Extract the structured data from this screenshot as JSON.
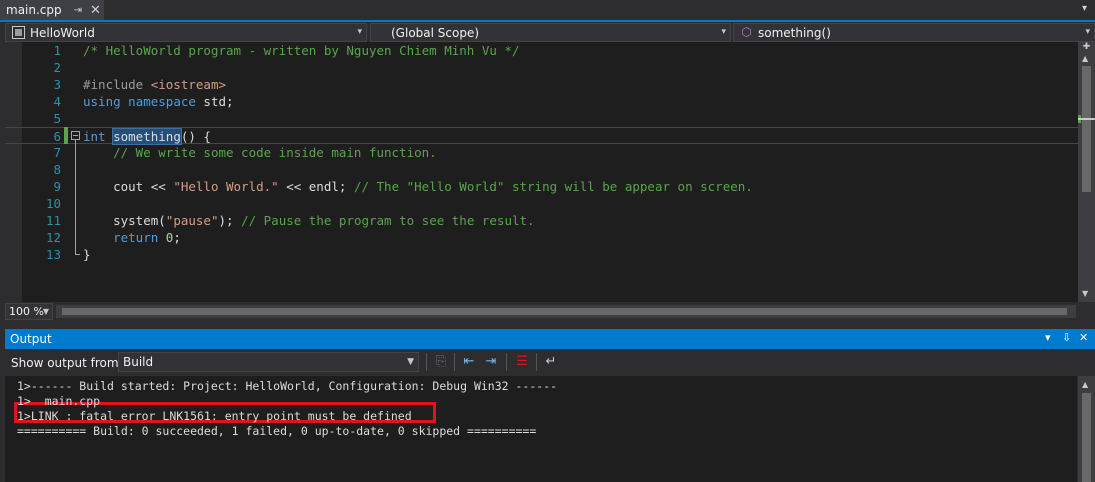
{
  "tabs": [
    {
      "label": "main.cpp",
      "pin": "⇥",
      "close": "✕"
    }
  ],
  "tab_overflow": "▾",
  "nav": {
    "project": "HelloWorld",
    "scope": "(Global Scope)",
    "function": "something()",
    "arrow": "▾"
  },
  "editor": {
    "zoom": "100 %",
    "current_line": 6,
    "lines": [
      {
        "n": "1",
        "tokens": [
          {
            "t": "/* HelloWorld program - written by Nguyen Chiem Minh Vu */",
            "c": "c-comment"
          }
        ]
      },
      {
        "n": "2",
        "tokens": []
      },
      {
        "n": "3",
        "tokens": [
          {
            "t": "#include ",
            "c": "c-pre"
          },
          {
            "t": "<iostream>",
            "c": "c-str"
          }
        ]
      },
      {
        "n": "4",
        "tokens": [
          {
            "t": "using",
            "c": "c-kw"
          },
          {
            "t": " ",
            "c": "c-plain"
          },
          {
            "t": "namespace",
            "c": "c-kw"
          },
          {
            "t": " std;",
            "c": "c-plain"
          }
        ]
      },
      {
        "n": "5",
        "tokens": []
      },
      {
        "n": "6",
        "tokens": [
          {
            "t": "int",
            "c": "c-kw"
          },
          {
            "t": " ",
            "c": "c-plain"
          },
          {
            "t": "something",
            "c": "c-fn"
          },
          {
            "t": "() {",
            "c": "c-plain"
          }
        ]
      },
      {
        "n": "7",
        "tokens": [
          {
            "t": "    ",
            "c": "c-plain"
          },
          {
            "t": "// We write some code inside main function.",
            "c": "c-comment"
          }
        ]
      },
      {
        "n": "8",
        "tokens": []
      },
      {
        "n": "9",
        "tokens": [
          {
            "t": "    cout << ",
            "c": "c-plain"
          },
          {
            "t": "\"Hello World.\"",
            "c": "c-str"
          },
          {
            "t": " << endl; ",
            "c": "c-plain"
          },
          {
            "t": "// The \"Hello World\" string will be appear on screen.",
            "c": "c-comment"
          }
        ]
      },
      {
        "n": "10",
        "tokens": []
      },
      {
        "n": "11",
        "tokens": [
          {
            "t": "    system(",
            "c": "c-plain"
          },
          {
            "t": "\"pause\"",
            "c": "c-str"
          },
          {
            "t": "); ",
            "c": "c-plain"
          },
          {
            "t": "// Pause the program to see the result.",
            "c": "c-comment"
          }
        ]
      },
      {
        "n": "12",
        "tokens": [
          {
            "t": "    ",
            "c": "c-plain"
          },
          {
            "t": "return",
            "c": "c-kw"
          },
          {
            "t": " ",
            "c": "c-plain"
          },
          {
            "t": "0",
            "c": "c-num"
          },
          {
            "t": ";",
            "c": "c-plain"
          }
        ]
      },
      {
        "n": "13",
        "tokens": [
          {
            "t": "}",
            "c": "c-plain"
          }
        ]
      }
    ]
  },
  "output": {
    "title": "Output",
    "controls": {
      "menu": "▾",
      "pin": "⇩",
      "close": "✕"
    },
    "show_from_label": "Show output from:",
    "source": "Build",
    "lines": [
      "1>------ Build started: Project: HelloWorld, Configuration: Debug Win32 ------",
      "1>  main.cpp",
      "1>LINK : fatal error LNK1561: entry point must be defined",
      "========== Build: 0 succeeded, 1 failed, 0 up-to-date, 0 skipped =========="
    ]
  },
  "colors": {
    "accent": "#007acc",
    "error_highlight": "#e0141e",
    "comment": "#57a64a",
    "keyword": "#569cd6",
    "string": "#d69d85"
  }
}
